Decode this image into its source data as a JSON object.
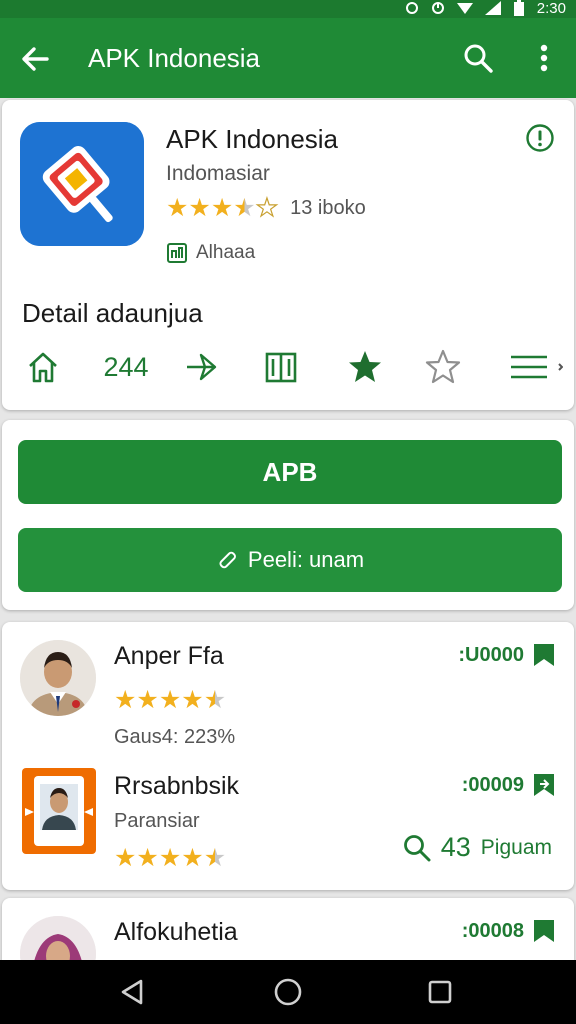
{
  "status_bar": {
    "time": "2:30"
  },
  "app_bar": {
    "title": "APK Indonesia"
  },
  "app": {
    "name": "APK Indonesia",
    "developer": "Indomasiar",
    "rating": 3.5,
    "rating_count": "13 iboko",
    "tag": "Alhaaa",
    "icon": "app-logo-icon",
    "colors": {
      "accent": "#1f8a36",
      "star": "#f2b01e",
      "icon_bg": "#1e73d2"
    }
  },
  "details": {
    "title": "Detail adaunjua",
    "count": "244"
  },
  "actions": {
    "primary_label": "APB",
    "secondary_label": "Peeli: unam"
  },
  "reviews": [
    {
      "name": "Anper Ffa",
      "subtitle": "Gaus4: 223%",
      "rating": 4.5,
      "id": ":U0000"
    },
    {
      "name": "Rrsabnbsik",
      "subtitle": "Paransiar",
      "rating": 4.5,
      "id": ":00009",
      "stat_value": "43",
      "stat_label": "Piguam"
    },
    {
      "name": "Alfokuhetia",
      "id": ":00008"
    }
  ]
}
